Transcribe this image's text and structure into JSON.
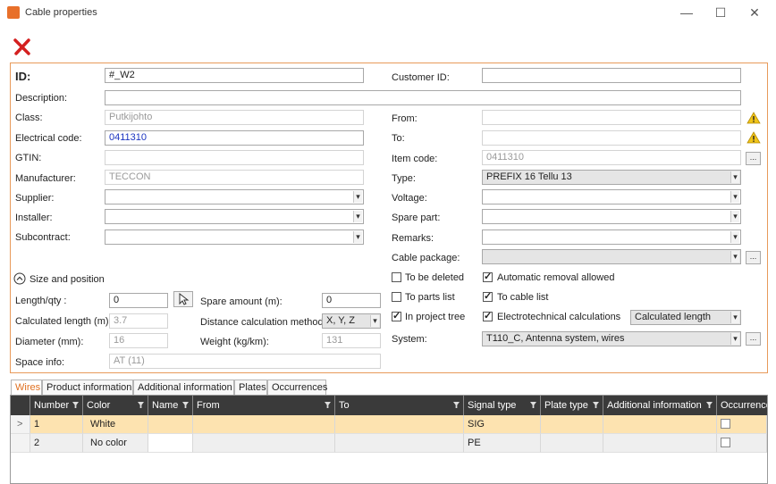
{
  "window": {
    "title": "Cable properties",
    "minimize": "—",
    "maximize": "☐",
    "close": "✕"
  },
  "form": {
    "id_label": "ID:",
    "id_value": "#_W2",
    "customer_id_label": "Customer ID:",
    "customer_id_value": "",
    "description_label": "Description:",
    "description_value": "",
    "class_label": "Class:",
    "class_value": "Putkijohto",
    "electrical_code_label": "Electrical code:",
    "electrical_code_value": "0411310",
    "gtin_label": "GTIN:",
    "gtin_value": "",
    "manufacturer_label": "Manufacturer:",
    "manufacturer_value": "TECCON",
    "supplier_label": "Supplier:",
    "supplier_value": "",
    "installer_label": "Installer:",
    "installer_value": "",
    "subcontract_label": "Subcontract:",
    "subcontract_value": "",
    "from_label": "From:",
    "from_value": "",
    "to_label": "To:",
    "to_value": "",
    "item_code_label": "Item code:",
    "item_code_value": "0411310",
    "type_label": "Type:",
    "type_value": "PREFIX 16 Tellu 13",
    "voltage_label": "Voltage:",
    "voltage_value": "",
    "spare_part_label": "Spare part:",
    "spare_part_value": "",
    "remarks_label": "Remarks:",
    "remarks_value": "",
    "cable_package_label": "Cable package:",
    "cable_package_value": "",
    "dots": "..."
  },
  "size_position": {
    "header": "Size and position",
    "length_label": "Length/qty :",
    "length_value": "0",
    "calc_length_label": "Calculated length (m):",
    "calc_length_value": "3.7",
    "diameter_label": "Diameter (mm):",
    "diameter_value": "16",
    "space_info_label": "Space info:",
    "space_info_value": "AT (11)",
    "spare_amount_label": "Spare amount (m):",
    "spare_amount_value": "0",
    "distance_method_label": "Distance calculation method:",
    "distance_method_value": "X, Y, Z",
    "weight_label": "Weight (kg/km):",
    "weight_value": "131"
  },
  "checkboxes": {
    "to_be_deleted": "To be deleted",
    "to_parts_list": "To parts list",
    "in_project_tree": "In project tree",
    "automatic_removal": "Automatic removal allowed",
    "to_cable_list": "To cable list",
    "electrotechnical": "Electrotechnical calculations",
    "calc_select": "Calculated length"
  },
  "system": {
    "label": "System:",
    "value": "T110_C, Antenna system, wires"
  },
  "tabs": [
    "Wires",
    "Product information",
    "Additional information",
    "Plates",
    "Occurrences"
  ],
  "grid": {
    "headers": [
      "Number",
      "Color",
      "Name",
      "From",
      "To",
      "Signal type",
      "Plate type",
      "Additional information",
      "Occurrence"
    ],
    "rows": [
      {
        "number": "1",
        "color": "White",
        "name": "",
        "from": "",
        "to": "",
        "signal": "SIG",
        "plate": "",
        "info": "",
        "marker": ">"
      },
      {
        "number": "2",
        "color": "No color",
        "name": "",
        "from": "",
        "to": "",
        "signal": "PE",
        "plate": "",
        "info": "",
        "marker": ""
      }
    ]
  },
  "colors": {
    "accent": "#e07020",
    "selected_row": "#fde3b0",
    "header_bg": "#3a3a3a",
    "warning": "#f0c419",
    "delete_red": "#d42020"
  }
}
